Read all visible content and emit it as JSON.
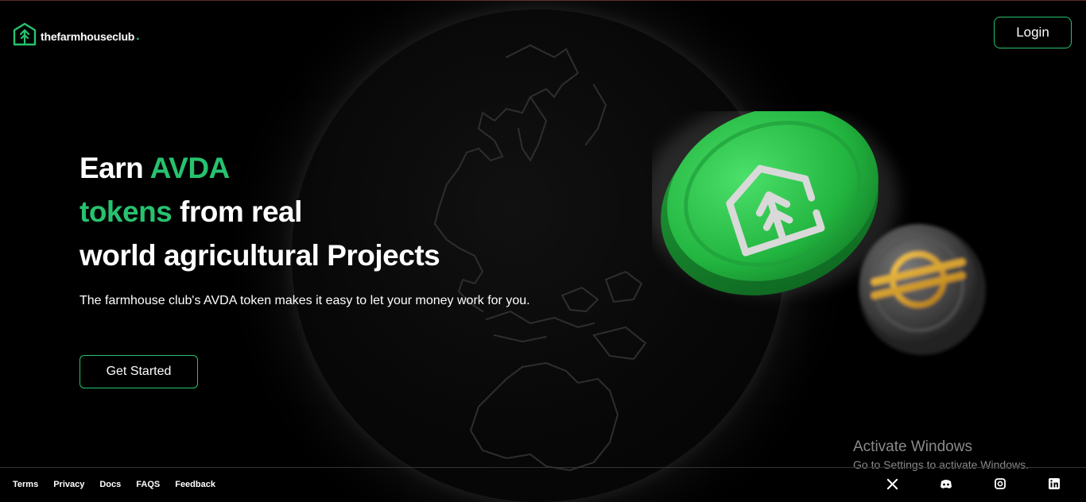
{
  "brand": {
    "name": "thefarmhouseclub",
    "dot": ".",
    "accent_color": "#27c26f"
  },
  "header": {
    "login_label": "Login"
  },
  "hero": {
    "title_part1": "Earn ",
    "title_accent1": "AVDA",
    "title_accent2": "tokens",
    "title_part2": " from real",
    "title_line3": "world agricultural Projects",
    "subtitle": "The farmhouse club's AVDA token makes it easy to let your money work for you.",
    "cta_label": "Get Started"
  },
  "watermark": {
    "title": "Activate Windows",
    "subtitle": "Go to Settings to activate Windows."
  },
  "footer": {
    "links": [
      "Terms",
      "Privacy",
      "Docs",
      "FAQS",
      "Feedback"
    ],
    "socials": [
      "x-icon",
      "discord-icon",
      "instagram-icon",
      "linkedin-icon"
    ]
  }
}
